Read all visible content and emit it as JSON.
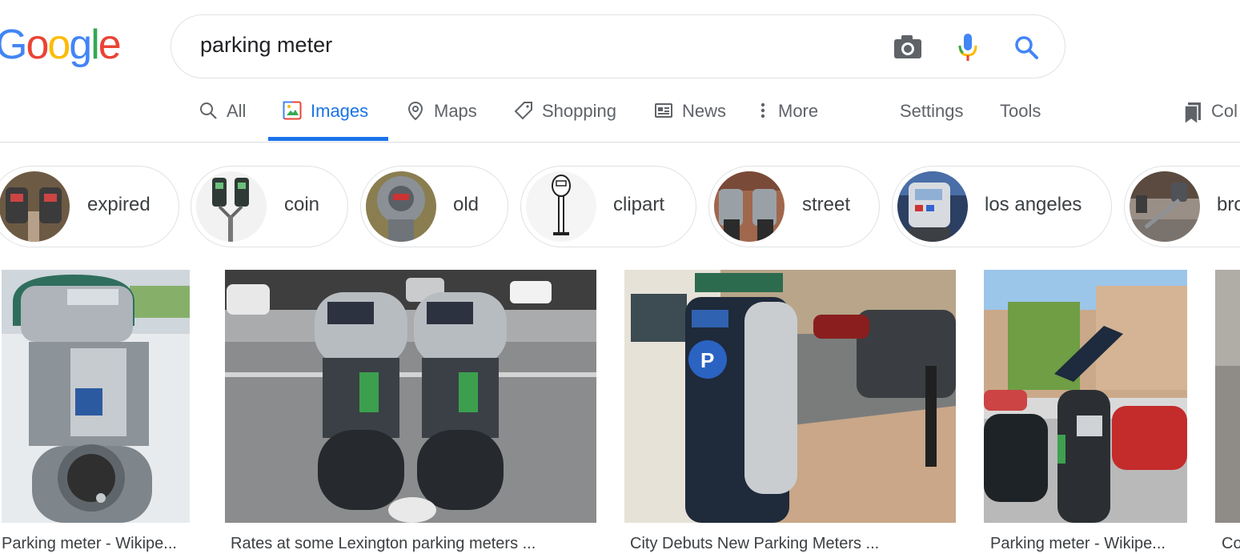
{
  "logo": {
    "letters": [
      "G",
      "o",
      "o",
      "g",
      "l",
      "e"
    ]
  },
  "search": {
    "query": "parking meter"
  },
  "tabs": [
    {
      "label": "All",
      "icon": "search-icon"
    },
    {
      "label": "Images",
      "icon": "image-icon"
    },
    {
      "label": "Maps",
      "icon": "map-pin-icon"
    },
    {
      "label": "Shopping",
      "icon": "tag-icon"
    },
    {
      "label": "News",
      "icon": "newspaper-icon"
    },
    {
      "label": "More",
      "icon": "more-vertical-icon"
    },
    {
      "label": "Settings"
    },
    {
      "label": "Tools"
    },
    {
      "label": "Col",
      "icon": "bookmark-icon"
    }
  ],
  "chips": [
    {
      "label": "expired"
    },
    {
      "label": "coin"
    },
    {
      "label": "old"
    },
    {
      "label": "clipart"
    },
    {
      "label": "street"
    },
    {
      "label": "los angeles"
    },
    {
      "label": "bro"
    }
  ],
  "results": [
    {
      "caption": "Parking meter - Wikipe..."
    },
    {
      "caption": "Rates at some Lexington parking meters ..."
    },
    {
      "caption": "City Debuts New Parking Meters ..."
    },
    {
      "caption": "Parking meter - Wikipe..."
    },
    {
      "caption": "Co"
    }
  ],
  "colors": {
    "blue": "#4285f4",
    "red": "#ea4335",
    "yellow": "#fbbc05",
    "green": "#34a853",
    "accent": "#1a73e8"
  }
}
